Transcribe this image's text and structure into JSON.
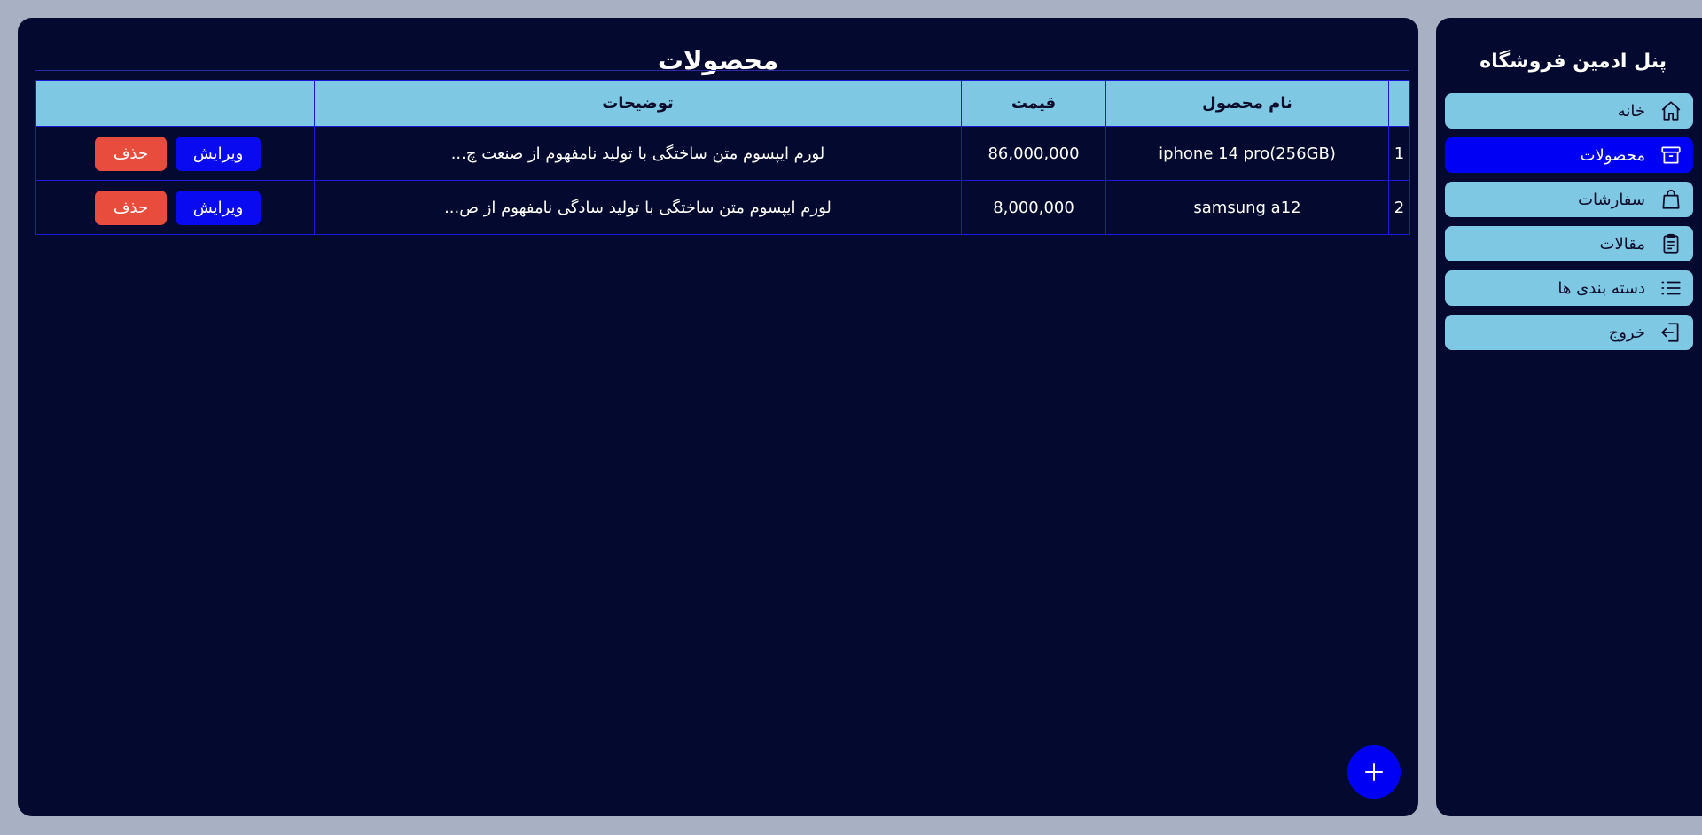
{
  "main": {
    "title": "محصولات",
    "table": {
      "headers": [
        "",
        "نام محصول",
        "قیمت",
        "توضیحات",
        ""
      ],
      "rows": [
        {
          "index": "1",
          "name": "iphone 14 pro(256GB)",
          "price": "86,000,000",
          "description": "لورم ایپسوم متن ساختگی با تولید نامفهوم از صنعت چ...",
          "edit_label": "ویرایش",
          "delete_label": "حذف"
        },
        {
          "index": "2",
          "name": "samsung a12",
          "price": "8,000,000",
          "description": "لورم ایپسوم متن ساختگی با تولید سادگی نامفهوم از ص...",
          "edit_label": "ویرایش",
          "delete_label": "حذف"
        }
      ]
    },
    "add_button_icon": "plus-icon"
  },
  "sidebar": {
    "title": "پنل ادمین فروشگاه",
    "items": [
      {
        "label": "خانه",
        "icon": "home-icon",
        "active": false
      },
      {
        "label": "محصولات",
        "icon": "archive-box-icon",
        "active": true
      },
      {
        "label": "سفارشات",
        "icon": "shopping-bag-icon",
        "active": false
      },
      {
        "label": "مقالات",
        "icon": "clipboard-icon",
        "active": false
      },
      {
        "label": "دسته بندی ها",
        "icon": "list-icon",
        "active": false
      },
      {
        "label": "خروج",
        "icon": "logout-icon",
        "active": false
      }
    ]
  },
  "colors": {
    "page_background": "#a7b1c3",
    "panel_background": "#040a2f",
    "accent": "#0000f5",
    "table_header": "#7ec8e3",
    "danger": "#e84c3d"
  }
}
